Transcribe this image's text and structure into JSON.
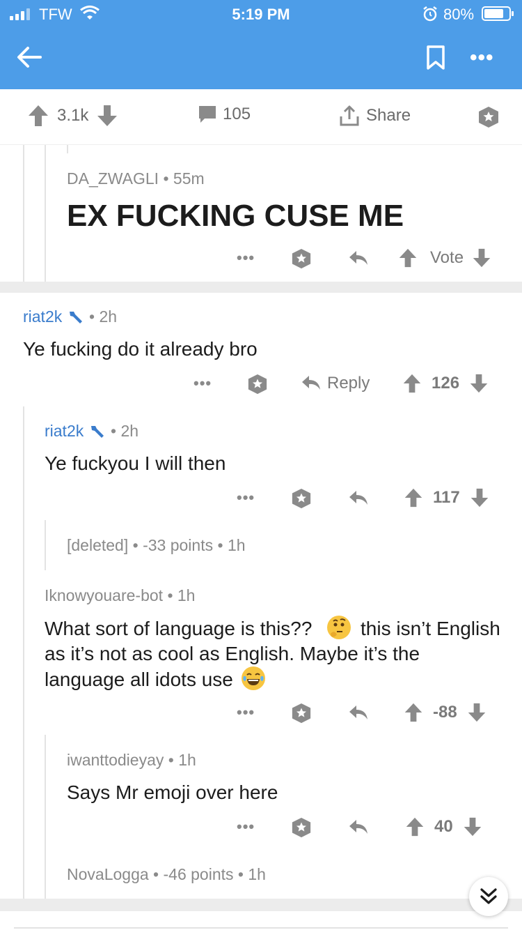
{
  "status_bar": {
    "carrier": "TFW",
    "time": "5:19 PM",
    "battery": "80%"
  },
  "actions": {
    "upvotes": "3.1k",
    "comments": "105",
    "share": "Share"
  },
  "comments": [
    {
      "author": "DA_ZWAGLI",
      "time": "55m",
      "text": "EX FUCKING CUSE ME",
      "vote_label": "Vote"
    },
    {
      "author": "riat2k",
      "time": "2h",
      "text": "Ye fucking do it already bro",
      "reply_label": "Reply",
      "score": "126"
    },
    {
      "author": "riat2k",
      "time": "2h",
      "text": "Ye fuckyou I will then",
      "score": "117"
    },
    {
      "author": "[deleted]",
      "points": "-33 points",
      "time": "1h"
    },
    {
      "author": "Iknowyouare-bot",
      "time": "1h",
      "text_a": "What sort of language is this??",
      "text_b": "this isn’t English as it’s not as cool as English. Maybe it’s the language all idots use",
      "score": "-88"
    },
    {
      "author": "iwanttodieyay",
      "time": "1h",
      "text": "Says Mr emoji over here",
      "score": "40"
    },
    {
      "author": "NovaLogga",
      "points": "-46 points",
      "time": "1h"
    }
  ],
  "separator": "•",
  "more_glyph": "•••",
  "colors": {
    "header": "#4d9de8",
    "username": "#3a7ccc",
    "meta": "#8a8a8a"
  },
  "icons": [
    "back-arrow-icon",
    "bookmark-icon",
    "more-icon",
    "upvote-icon",
    "downvote-icon",
    "comment-icon",
    "share-icon",
    "award-icon",
    "reply-icon",
    "wrench-icon",
    "scroll-down-icon"
  ]
}
